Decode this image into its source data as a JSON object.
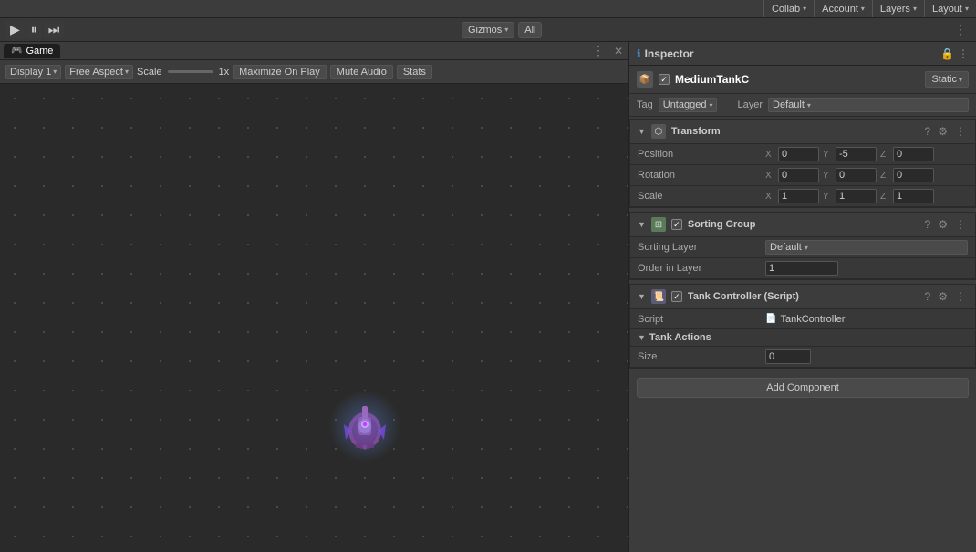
{
  "topbar": {
    "collab_label": "Collab",
    "account_label": "Account",
    "layers_label": "Layers",
    "layout_label": "Layout"
  },
  "toolbar": {
    "gizmos_label": "Gizmos",
    "all_label": "All"
  },
  "game_panel": {
    "tab_label": "Game",
    "display_label": "Display 1",
    "aspect_label": "Free Aspect",
    "scale_label": "Scale",
    "scale_value": "1x",
    "maximize_label": "Maximize On Play",
    "mute_label": "Mute Audio",
    "stats_label": "Stats"
  },
  "inspector": {
    "title": "Inspector",
    "object_name": "MediumTankC",
    "static_label": "Static",
    "tag_label": "Tag",
    "tag_value": "Untagged",
    "layer_label": "Layer",
    "layer_value": "Default"
  },
  "transform": {
    "header": "Transform",
    "position_label": "Position",
    "pos_x": "0",
    "pos_y": "-5",
    "pos_z": "0",
    "rotation_label": "Rotation",
    "rot_x": "0",
    "rot_y": "0",
    "rot_z": "0",
    "scale_label": "Scale",
    "scale_x": "1",
    "scale_y": "1",
    "scale_z": "1"
  },
  "sorting_group": {
    "header": "Sorting Group",
    "sorting_layer_label": "Sorting Layer",
    "sorting_layer_value": "Default",
    "order_label": "Order in Layer",
    "order_value": "1"
  },
  "tank_controller": {
    "header": "Tank Controller (Script)",
    "script_label": "Script",
    "script_name": "TankController",
    "tank_actions_label": "Tank Actions",
    "size_label": "Size",
    "size_value": "0"
  },
  "add_component": {
    "label": "Add Component"
  }
}
